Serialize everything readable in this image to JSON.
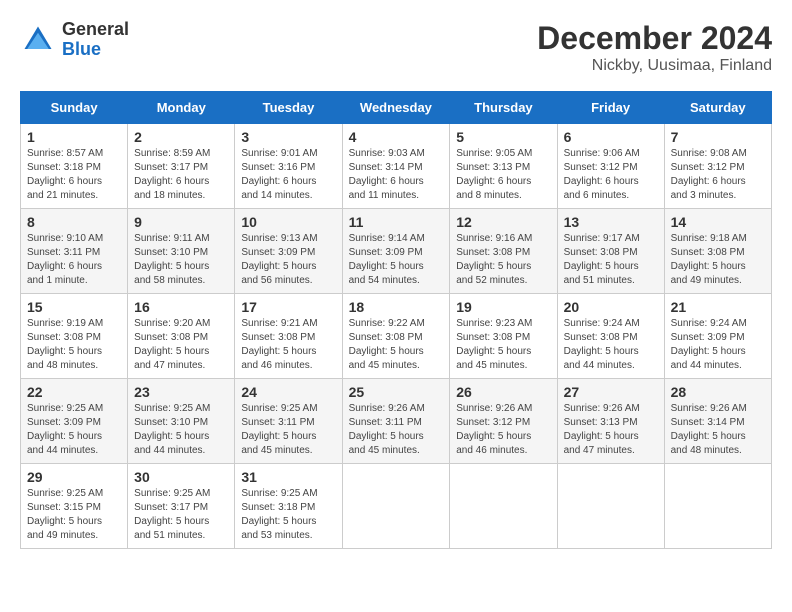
{
  "header": {
    "logo": {
      "general": "General",
      "blue": "Blue"
    },
    "title": "December 2024",
    "subtitle": "Nickby, Uusimaa, Finland"
  },
  "calendar": {
    "days_of_week": [
      "Sunday",
      "Monday",
      "Tuesday",
      "Wednesday",
      "Thursday",
      "Friday",
      "Saturday"
    ],
    "weeks": [
      [
        {
          "day": "1",
          "info": "Sunrise: 8:57 AM\nSunset: 3:18 PM\nDaylight: 6 hours\nand 21 minutes."
        },
        {
          "day": "2",
          "info": "Sunrise: 8:59 AM\nSunset: 3:17 PM\nDaylight: 6 hours\nand 18 minutes."
        },
        {
          "day": "3",
          "info": "Sunrise: 9:01 AM\nSunset: 3:16 PM\nDaylight: 6 hours\nand 14 minutes."
        },
        {
          "day": "4",
          "info": "Sunrise: 9:03 AM\nSunset: 3:14 PM\nDaylight: 6 hours\nand 11 minutes."
        },
        {
          "day": "5",
          "info": "Sunrise: 9:05 AM\nSunset: 3:13 PM\nDaylight: 6 hours\nand 8 minutes."
        },
        {
          "day": "6",
          "info": "Sunrise: 9:06 AM\nSunset: 3:12 PM\nDaylight: 6 hours\nand 6 minutes."
        },
        {
          "day": "7",
          "info": "Sunrise: 9:08 AM\nSunset: 3:12 PM\nDaylight: 6 hours\nand 3 minutes."
        }
      ],
      [
        {
          "day": "8",
          "info": "Sunrise: 9:10 AM\nSunset: 3:11 PM\nDaylight: 6 hours\nand 1 minute."
        },
        {
          "day": "9",
          "info": "Sunrise: 9:11 AM\nSunset: 3:10 PM\nDaylight: 5 hours\nand 58 minutes."
        },
        {
          "day": "10",
          "info": "Sunrise: 9:13 AM\nSunset: 3:09 PM\nDaylight: 5 hours\nand 56 minutes."
        },
        {
          "day": "11",
          "info": "Sunrise: 9:14 AM\nSunset: 3:09 PM\nDaylight: 5 hours\nand 54 minutes."
        },
        {
          "day": "12",
          "info": "Sunrise: 9:16 AM\nSunset: 3:08 PM\nDaylight: 5 hours\nand 52 minutes."
        },
        {
          "day": "13",
          "info": "Sunrise: 9:17 AM\nSunset: 3:08 PM\nDaylight: 5 hours\nand 51 minutes."
        },
        {
          "day": "14",
          "info": "Sunrise: 9:18 AM\nSunset: 3:08 PM\nDaylight: 5 hours\nand 49 minutes."
        }
      ],
      [
        {
          "day": "15",
          "info": "Sunrise: 9:19 AM\nSunset: 3:08 PM\nDaylight: 5 hours\nand 48 minutes."
        },
        {
          "day": "16",
          "info": "Sunrise: 9:20 AM\nSunset: 3:08 PM\nDaylight: 5 hours\nand 47 minutes."
        },
        {
          "day": "17",
          "info": "Sunrise: 9:21 AM\nSunset: 3:08 PM\nDaylight: 5 hours\nand 46 minutes."
        },
        {
          "day": "18",
          "info": "Sunrise: 9:22 AM\nSunset: 3:08 PM\nDaylight: 5 hours\nand 45 minutes."
        },
        {
          "day": "19",
          "info": "Sunrise: 9:23 AM\nSunset: 3:08 PM\nDaylight: 5 hours\nand 45 minutes."
        },
        {
          "day": "20",
          "info": "Sunrise: 9:24 AM\nSunset: 3:08 PM\nDaylight: 5 hours\nand 44 minutes."
        },
        {
          "day": "21",
          "info": "Sunrise: 9:24 AM\nSunset: 3:09 PM\nDaylight: 5 hours\nand 44 minutes."
        }
      ],
      [
        {
          "day": "22",
          "info": "Sunrise: 9:25 AM\nSunset: 3:09 PM\nDaylight: 5 hours\nand 44 minutes."
        },
        {
          "day": "23",
          "info": "Sunrise: 9:25 AM\nSunset: 3:10 PM\nDaylight: 5 hours\nand 44 minutes."
        },
        {
          "day": "24",
          "info": "Sunrise: 9:25 AM\nSunset: 3:11 PM\nDaylight: 5 hours\nand 45 minutes."
        },
        {
          "day": "25",
          "info": "Sunrise: 9:26 AM\nSunset: 3:11 PM\nDaylight: 5 hours\nand 45 minutes."
        },
        {
          "day": "26",
          "info": "Sunrise: 9:26 AM\nSunset: 3:12 PM\nDaylight: 5 hours\nand 46 minutes."
        },
        {
          "day": "27",
          "info": "Sunrise: 9:26 AM\nSunset: 3:13 PM\nDaylight: 5 hours\nand 47 minutes."
        },
        {
          "day": "28",
          "info": "Sunrise: 9:26 AM\nSunset: 3:14 PM\nDaylight: 5 hours\nand 48 minutes."
        }
      ],
      [
        {
          "day": "29",
          "info": "Sunrise: 9:25 AM\nSunset: 3:15 PM\nDaylight: 5 hours\nand 49 minutes."
        },
        {
          "day": "30",
          "info": "Sunrise: 9:25 AM\nSunset: 3:17 PM\nDaylight: 5 hours\nand 51 minutes."
        },
        {
          "day": "31",
          "info": "Sunrise: 9:25 AM\nSunset: 3:18 PM\nDaylight: 5 hours\nand 53 minutes."
        },
        null,
        null,
        null,
        null
      ]
    ]
  }
}
